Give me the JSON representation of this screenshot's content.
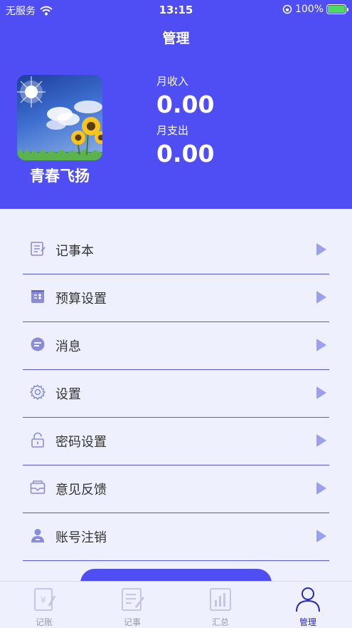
{
  "status_bar": {
    "carrier": "无服务",
    "time": "13:15",
    "battery": "100%"
  },
  "nav": {
    "title": "管理"
  },
  "profile": {
    "name": "青春飞扬"
  },
  "stats": {
    "income_label": "月收入",
    "income_value": "0.00",
    "expense_label": "月支出",
    "expense_value": "0.00"
  },
  "menu": [
    {
      "label": "记事本",
      "icon": "notebook-icon"
    },
    {
      "label": "预算设置",
      "icon": "calculator-icon"
    },
    {
      "label": "消息",
      "icon": "message-icon"
    },
    {
      "label": "设置",
      "icon": "gear-icon"
    },
    {
      "label": "密码设置",
      "icon": "lock-icon"
    },
    {
      "label": "意见反馈",
      "icon": "mail-icon"
    },
    {
      "label": "账号注销",
      "icon": "user-icon"
    }
  ],
  "tabs": [
    {
      "label": "记账",
      "icon": "ledger-icon"
    },
    {
      "label": "记事",
      "icon": "notes-icon"
    },
    {
      "label": "汇总",
      "icon": "summary-chart-icon"
    },
    {
      "label": "管理",
      "icon": "person-icon",
      "active": true
    }
  ],
  "colors": {
    "primary": "#4f4ef5",
    "background": "#eef0fd",
    "arrow": "#9c9ef0",
    "divider": "#5757d8"
  }
}
